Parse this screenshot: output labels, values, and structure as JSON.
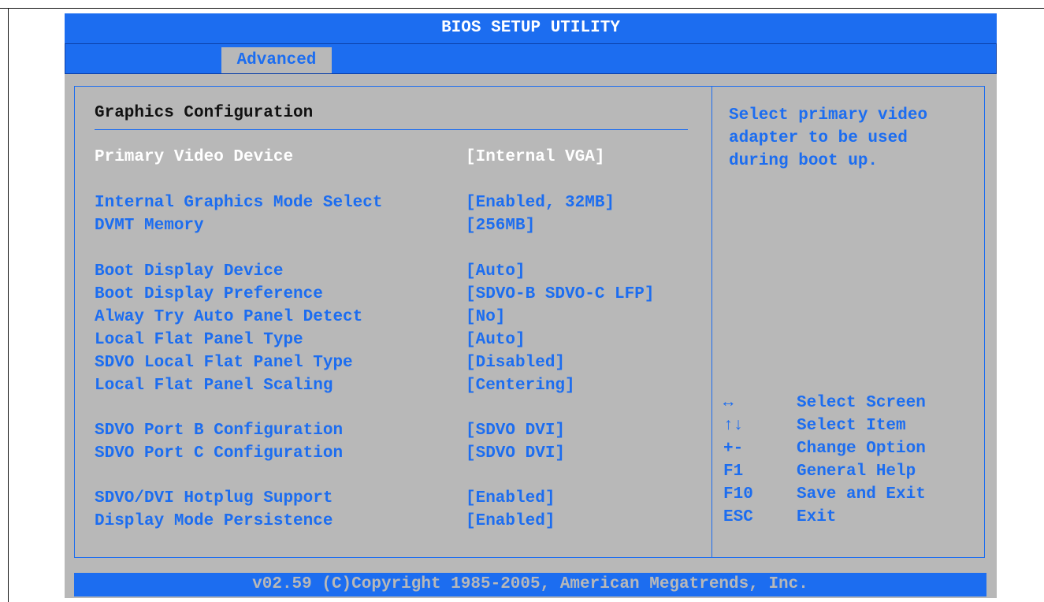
{
  "title": "BIOS SETUP UTILITY",
  "tabs": [
    {
      "label": "Advanced"
    }
  ],
  "section_title": "Graphics Configuration",
  "settings": [
    {
      "label": "Primary Video Device",
      "value": "[Internal VGA]"
    },
    {
      "label": "Internal Graphics Mode Select",
      "value": "[Enabled, 32MB]"
    },
    {
      "label": "DVMT Memory",
      "value": "[256MB]"
    },
    {
      "label": "Boot Display Device",
      "value": "[Auto]"
    },
    {
      "label": "Boot Display Preference",
      "value": "[SDVO-B SDVO-C LFP]"
    },
    {
      "label": "Alway Try Auto Panel Detect",
      "value": "[No]"
    },
    {
      "label": "Local Flat Panel Type",
      "value": "[Auto]"
    },
    {
      "label": "SDVO Local Flat Panel Type",
      "value": "[Disabled]"
    },
    {
      "label": "Local Flat Panel Scaling",
      "value": "[Centering]"
    },
    {
      "label": "SDVO Port B Configuration",
      "value": "[SDVO DVI]"
    },
    {
      "label": "SDVO Port C Configuration",
      "value": "[SDVO DVI]"
    },
    {
      "label": "SDVO/DVI Hotplug Support",
      "value": "[Enabled]"
    },
    {
      "label": "Display Mode Persistence",
      "value": "[Enabled]"
    }
  ],
  "help_lines": [
    "Select primary video",
    "adapter to be used",
    "during boot up."
  ],
  "keys": [
    {
      "key": "↔",
      "desc": "Select Screen",
      "icon": "left-right-arrow-icon"
    },
    {
      "key": "↑↓",
      "desc": "Select Item",
      "icon": "up-down-arrow-icon"
    },
    {
      "key": "+-",
      "desc": "Change Option"
    },
    {
      "key": "F1",
      "desc": "General Help"
    },
    {
      "key": "F10",
      "desc": "Save and Exit"
    },
    {
      "key": "ESC",
      "desc": "Exit"
    }
  ],
  "footer": "v02.59 (C)Copyright 1985-2005, American Megatrends, Inc.",
  "colors": {
    "accent": "#1c6df0",
    "background": "#b8b8b8",
    "selected_text": "#ffffff"
  }
}
